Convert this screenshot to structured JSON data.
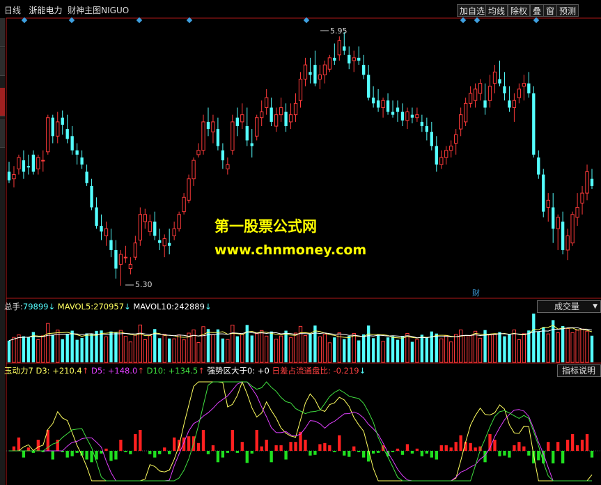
{
  "header": {
    "period": "日线",
    "stock_name": "浙能电力",
    "indicator_name": "财神主图NIGUO"
  },
  "toolbar": {
    "buttons": [
      "加自选",
      "均线",
      "除权",
      "叠",
      "窗",
      "预测"
    ]
  },
  "price_panel": {
    "high_label": "5.95",
    "low_label": "5.30",
    "marker_label": "财",
    "candles": [
      [
        6.1,
        6.17,
        6.02,
        6.04
      ],
      [
        6.05,
        6.14,
        5.99,
        6.08
      ],
      [
        6.12,
        6.22,
        6.08,
        6.2
      ],
      [
        6.18,
        6.25,
        6.05,
        6.1
      ],
      [
        6.14,
        6.22,
        6.08,
        6.13
      ],
      [
        6.22,
        6.25,
        6.08,
        6.1
      ],
      [
        6.12,
        6.22,
        6.08,
        6.2
      ],
      [
        6.18,
        6.25,
        6.1,
        6.18
      ],
      [
        6.24,
        6.5,
        6.22,
        6.48
      ],
      [
        6.48,
        6.5,
        6.3,
        6.35
      ],
      [
        6.35,
        6.52,
        6.3,
        6.45
      ],
      [
        6.48,
        6.53,
        6.36,
        6.43
      ],
      [
        6.4,
        6.5,
        6.3,
        6.33
      ],
      [
        6.35,
        6.42,
        6.22,
        6.25
      ],
      [
        6.25,
        6.3,
        6.15,
        6.22
      ],
      [
        6.2,
        6.25,
        6.12,
        6.15
      ],
      [
        6.1,
        6.15,
        6.0,
        6.02
      ],
      [
        6.0,
        6.05,
        5.83,
        5.85
      ],
      [
        5.85,
        5.92,
        5.7,
        5.72
      ],
      [
        5.72,
        5.8,
        5.62,
        5.68
      ],
      [
        5.65,
        5.75,
        5.58,
        5.7
      ],
      [
        5.62,
        5.7,
        5.5,
        5.55
      ],
      [
        5.55,
        5.62,
        5.35,
        5.42
      ],
      [
        5.45,
        5.55,
        5.3,
        5.52
      ],
      [
        5.5,
        5.58,
        5.46,
        5.5
      ],
      [
        5.42,
        5.5,
        5.38,
        5.45
      ],
      [
        5.5,
        5.65,
        5.48,
        5.6
      ],
      [
        5.62,
        5.85,
        5.58,
        5.8
      ],
      [
        5.75,
        5.84,
        5.7,
        5.8
      ],
      [
        5.68,
        5.8,
        5.65,
        5.75
      ],
      [
        5.75,
        5.82,
        5.62,
        5.65
      ],
      [
        5.62,
        5.7,
        5.55,
        5.6
      ],
      [
        5.58,
        5.66,
        5.5,
        5.63
      ],
      [
        5.6,
        5.7,
        5.52,
        5.58
      ],
      [
        5.65,
        5.75,
        5.62,
        5.7
      ],
      [
        5.7,
        5.82,
        5.68,
        5.8
      ],
      [
        5.82,
        5.95,
        5.8,
        5.92
      ],
      [
        5.9,
        6.08,
        5.88,
        6.05
      ],
      [
        6.05,
        6.2,
        6.0,
        6.18
      ],
      [
        6.22,
        6.3,
        6.2,
        6.25
      ],
      [
        6.25,
        6.5,
        6.22,
        6.45
      ],
      [
        6.45,
        6.55,
        6.35,
        6.4
      ],
      [
        6.38,
        6.5,
        6.3,
        6.45
      ],
      [
        6.4,
        6.48,
        6.25,
        6.28
      ],
      [
        6.25,
        6.3,
        6.12,
        6.18
      ],
      [
        6.12,
        6.2,
        6.08,
        6.15
      ],
      [
        6.25,
        6.5,
        6.22,
        6.45
      ],
      [
        6.48,
        6.55,
        6.35,
        6.42
      ],
      [
        6.45,
        6.58,
        6.4,
        6.5
      ],
      [
        6.42,
        6.55,
        6.28,
        6.32
      ],
      [
        6.3,
        6.4,
        6.2,
        6.28
      ],
      [
        6.35,
        6.5,
        6.32,
        6.48
      ],
      [
        6.48,
        6.6,
        6.42,
        6.52
      ],
      [
        6.55,
        6.68,
        6.5,
        6.62
      ],
      [
        6.55,
        6.62,
        6.42,
        6.45
      ],
      [
        6.42,
        6.55,
        6.38,
        6.5
      ],
      [
        6.5,
        6.62,
        6.45,
        6.55
      ],
      [
        6.52,
        6.58,
        6.38,
        6.42
      ],
      [
        6.45,
        6.58,
        6.4,
        6.5
      ],
      [
        6.5,
        6.65,
        6.45,
        6.58
      ],
      [
        6.6,
        6.8,
        6.55,
        6.75
      ],
      [
        6.75,
        6.9,
        6.7,
        6.85
      ],
      [
        6.8,
        6.9,
        6.72,
        6.78
      ],
      [
        6.85,
        6.95,
        6.7,
        6.72
      ],
      [
        6.75,
        6.85,
        6.68,
        6.78
      ],
      [
        6.78,
        6.88,
        6.72,
        6.85
      ],
      [
        6.82,
        6.92,
        6.8,
        6.9
      ],
      [
        6.9,
        7.0,
        6.85,
        6.88
      ],
      [
        6.92,
        7.05,
        6.88,
        7.02
      ],
      [
        6.98,
        7.08,
        6.92,
        6.95
      ],
      [
        6.92,
        6.98,
        6.82,
        6.86
      ],
      [
        6.88,
        6.95,
        6.8,
        6.9
      ],
      [
        6.9,
        6.98,
        6.85,
        6.88
      ],
      [
        6.85,
        6.92,
        6.75,
        6.78
      ],
      [
        6.78,
        6.85,
        6.6,
        6.62
      ],
      [
        6.62,
        6.7,
        6.55,
        6.58
      ],
      [
        6.6,
        6.68,
        6.52,
        6.55
      ],
      [
        6.55,
        6.62,
        6.48,
        6.6
      ],
      [
        6.6,
        6.65,
        6.5,
        6.52
      ],
      [
        6.52,
        6.6,
        6.48,
        6.5
      ],
      [
        6.55,
        6.6,
        6.45,
        6.52
      ],
      [
        6.52,
        6.58,
        6.42,
        6.46
      ],
      [
        6.46,
        6.55,
        6.4,
        6.52
      ],
      [
        6.5,
        6.55,
        6.44,
        6.48
      ],
      [
        6.48,
        6.55,
        6.45,
        6.5
      ],
      [
        6.45,
        6.5,
        6.38,
        6.42
      ],
      [
        6.42,
        6.48,
        6.32,
        6.38
      ],
      [
        6.38,
        6.45,
        6.25,
        6.28
      ],
      [
        6.28,
        6.35,
        6.1,
        6.15
      ],
      [
        6.15,
        6.25,
        6.12,
        6.2
      ],
      [
        6.2,
        6.28,
        6.15,
        6.25
      ],
      [
        6.25,
        6.32,
        6.2,
        6.28
      ],
      [
        6.3,
        6.4,
        6.22,
        6.36
      ],
      [
        6.4,
        6.55,
        6.35,
        6.5
      ],
      [
        6.45,
        6.62,
        6.42,
        6.58
      ],
      [
        6.58,
        6.7,
        6.55,
        6.65
      ],
      [
        6.6,
        6.72,
        6.55,
        6.68
      ],
      [
        6.65,
        6.75,
        6.6,
        6.72
      ],
      [
        6.6,
        6.72,
        6.5,
        6.55
      ],
      [
        6.6,
        6.78,
        6.55,
        6.7
      ],
      [
        6.72,
        6.85,
        6.65,
        6.8
      ],
      [
        6.75,
        6.88,
        6.7,
        6.72
      ],
      [
        6.7,
        6.8,
        6.6,
        6.65
      ],
      [
        6.6,
        6.7,
        6.52,
        6.55
      ],
      [
        6.55,
        6.65,
        6.45,
        6.6
      ],
      [
        6.62,
        6.72,
        6.58,
        6.68
      ],
      [
        6.7,
        6.78,
        6.6,
        6.72
      ],
      [
        6.72,
        6.8,
        6.62,
        6.65
      ],
      [
        6.65,
        6.7,
        6.2,
        6.22
      ],
      [
        6.2,
        6.25,
        6.05,
        6.08
      ],
      [
        6.08,
        6.12,
        5.78,
        5.82
      ],
      [
        5.85,
        5.95,
        5.75,
        5.9
      ],
      [
        5.85,
        5.95,
        5.6,
        5.7
      ],
      [
        5.7,
        5.8,
        5.55,
        5.78
      ],
      [
        5.75,
        5.82,
        5.52,
        5.55
      ],
      [
        5.55,
        5.7,
        5.48,
        5.65
      ],
      [
        5.6,
        5.82,
        5.58,
        5.8
      ],
      [
        5.78,
        5.95,
        5.72,
        5.85
      ],
      [
        5.88,
        6.0,
        5.8,
        5.95
      ],
      [
        5.95,
        6.15,
        5.9,
        6.1
      ],
      [
        6.05,
        6.12,
        5.98,
        6.0
      ]
    ]
  },
  "volume_panel": {
    "label": "总手:",
    "value": "79899",
    "ma5_label": "MAVOL5:",
    "ma5_value": "270957",
    "ma10_label": "MAVOL10:",
    "ma10_value": "242889",
    "arrow": "↓",
    "dropdown": "成交量"
  },
  "indicator_panel": {
    "name": "玉动力7",
    "d3_label": "D3:",
    "d3_value": "+210.4",
    "d5_label": "D5:",
    "d5_value": "+148.0",
    "d10_label": "D10:",
    "d10_value": "+134.5",
    "strong_label": "强势区大于0:",
    "strong_value": "+0",
    "diff_label": "日差占流通盘比:",
    "diff_value": "-0.219",
    "up_arrow": "↑",
    "down_arrow": "↓",
    "help_button": "指标说明"
  },
  "watermark": {
    "line1": "第一股票公式网",
    "line2": "www.chnmoney.com"
  },
  "colors": {
    "up": "#ff3a3a",
    "down": "#54ffff",
    "frame": "#b01818",
    "ma5": "#ffff60",
    "ma10": "#e040ff",
    "d10": "#40e040"
  }
}
